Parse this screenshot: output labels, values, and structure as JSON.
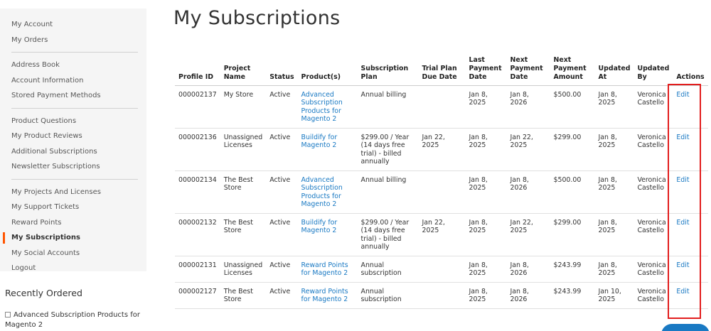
{
  "sidebar": {
    "groups": [
      [
        "My Account",
        "My Orders"
      ],
      [
        "Address Book",
        "Account Information",
        "Stored Payment Methods"
      ],
      [
        "Product Questions",
        "My Product Reviews",
        "Additional Subscriptions",
        "Newsletter Subscriptions"
      ],
      [
        "My Projects And Licenses",
        "My Support Tickets",
        "Reward Points",
        "My Subscriptions",
        "My Social Accounts",
        "Logout"
      ]
    ],
    "current": "My Subscriptions"
  },
  "recent": {
    "title": "Recently Ordered",
    "items": [
      "Advanced Subscription Products for Magento 2"
    ]
  },
  "page": {
    "title": "My Subscriptions"
  },
  "table": {
    "headers": [
      "Profile ID",
      "Project Name",
      "Status",
      "Product(s)",
      "Subscription Plan",
      "Trial Plan Due Date",
      "Last Payment Date",
      "Next Payment Date",
      "Next Payment Amount",
      "Updated At",
      "Updated By",
      "Actions"
    ],
    "rows": [
      {
        "profile_id": "000002137",
        "project": "My Store",
        "status": "Active",
        "product": "Advanced Subscription Products for Magento 2",
        "plan": "Annual billing",
        "trial_due": "",
        "last_payment": "Jan 8, 2025",
        "next_payment": "Jan 8, 2026",
        "amount": "$500.00",
        "updated_at": "Jan 8, 2025",
        "updated_by": "Veronica Castello",
        "action": "Edit"
      },
      {
        "profile_id": "000002136",
        "project": "Unassigned Licenses",
        "status": "Active",
        "product": "Buildify for Magento 2",
        "plan": "$299.00 / Year (14 days free trial) - billed annually",
        "trial_due": "Jan 22, 2025",
        "last_payment": "Jan 8, 2025",
        "next_payment": "Jan 22, 2025",
        "amount": "$299.00",
        "updated_at": "Jan 8, 2025",
        "updated_by": "Veronica Castello",
        "action": "Edit"
      },
      {
        "profile_id": "000002134",
        "project": "The Best Store",
        "status": "Active",
        "product": "Advanced Subscription Products for Magento 2",
        "plan": "Annual billing",
        "trial_due": "",
        "last_payment": "Jan 8, 2025",
        "next_payment": "Jan 8, 2026",
        "amount": "$500.00",
        "updated_at": "Jan 8, 2025",
        "updated_by": "Veronica Castello",
        "action": "Edit"
      },
      {
        "profile_id": "000002132",
        "project": "The Best Store",
        "status": "Active",
        "product": "Buildify for Magento 2",
        "plan": "$299.00 / Year (14 days free trial) - billed annually",
        "trial_due": "Jan 22, 2025",
        "last_payment": "Jan 8, 2025",
        "next_payment": "Jan 22, 2025",
        "amount": "$299.00",
        "updated_at": "Jan 8, 2025",
        "updated_by": "Veronica Castello",
        "action": "Edit"
      },
      {
        "profile_id": "000002131",
        "project": "Unassigned Licenses",
        "status": "Active",
        "product": "Reward Points for Magento 2",
        "plan": "Annual subscription",
        "trial_due": "",
        "last_payment": "Jan 8, 2025",
        "next_payment": "Jan 8, 2026",
        "amount": "$243.99",
        "updated_at": "Jan 8, 2025",
        "updated_by": "Veronica Castello",
        "action": "Edit"
      },
      {
        "profile_id": "000002127",
        "project": "The Best Store",
        "status": "Active",
        "product": "Reward Points for Magento 2",
        "plan": "Annual subscription",
        "trial_due": "",
        "last_payment": "Jan 8, 2025",
        "next_payment": "Jan 8, 2026",
        "amount": "$243.99",
        "updated_at": "Jan 10, 2025",
        "updated_by": "Veronica Castello",
        "action": "Edit"
      }
    ]
  },
  "colors": {
    "link": "#1979c3",
    "accent": "#ff5501",
    "highlight": "#e21d1d",
    "sidebar_bg": "#f5f5f5"
  }
}
